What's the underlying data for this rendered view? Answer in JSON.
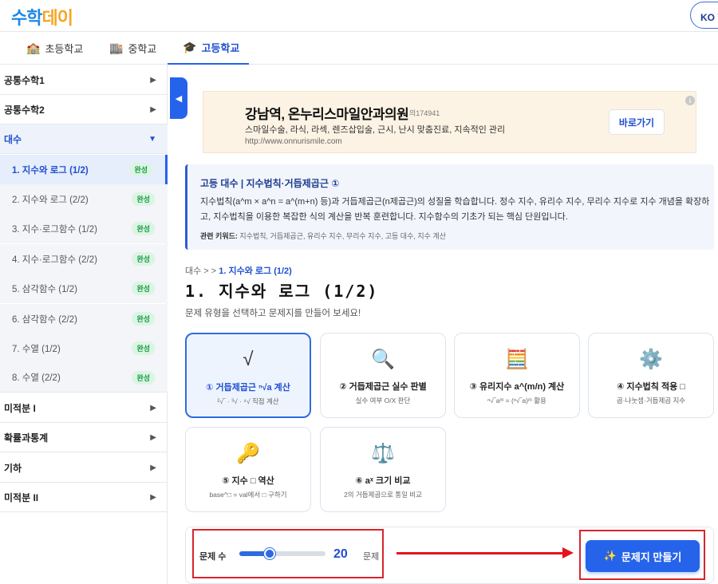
{
  "header": {
    "logo_main": "수학",
    "logo_accent": "데이",
    "lang_button": "KO 한"
  },
  "tabs": [
    {
      "label": "초등학교",
      "icon": "school-icon"
    },
    {
      "label": "중학교",
      "icon": "building-icon"
    },
    {
      "label": "고등학교",
      "icon": "graduation-cap-icon",
      "active": true
    }
  ],
  "sidebar": {
    "categories": {
      "c1": "공통수학1",
      "c2": "공통수학2",
      "c3": "대수",
      "c4": "미적분 I",
      "c5": "확률과통계",
      "c6": "기하",
      "c7": "미적분 II"
    },
    "items": [
      {
        "label": "1. 지수와 로그 (1/2)",
        "badge": "완성",
        "active": true
      },
      {
        "label": "2. 지수와 로그 (2/2)",
        "badge": "완성"
      },
      {
        "label": "3. 지수·로그함수 (1/2)",
        "badge": "완성"
      },
      {
        "label": "4. 지수·로그함수 (2/2)",
        "badge": "완성"
      },
      {
        "label": "5. 삼각함수 (1/2)",
        "badge": "완성"
      },
      {
        "label": "6. 삼각함수 (2/2)",
        "badge": "완성"
      },
      {
        "label": "7. 수열 (1/2)",
        "badge": "완성"
      },
      {
        "label": "8. 수열 (2/2)",
        "badge": "완성"
      }
    ]
  },
  "ad": {
    "title": "강남역, 온누리스마일안과의원",
    "id": "의174941",
    "desc": "스마일수술, 라식, 라섹, 렌즈삽입술, 근시, 난시 맞춤진료, 지속적인 관리",
    "url": "http://www.onnurismile.com",
    "button": "바로가기",
    "info": "i"
  },
  "info": {
    "title": "고등 대수 | 지수법칙·거듭제곱근 ①",
    "body": "지수법칙(a^m × a^n = a^(m+n) 등)과 거듭제곱근(n제곱근)의 성질을 학습합니다. 정수 지수, 유리수 지수, 무리수 지수로 지수 개념을 확장하고, 지수법칙을 이용한 복잡한 식의 계산을 반복 훈련합니다. 지수함수의 기초가 되는 핵심 단원입니다.",
    "keywords_label": "관련 키워드:",
    "keywords": "지수법칙, 거듭제곱근, 유리수 지수, 무리수 지수, 고등 대수, 지수 계산"
  },
  "breadcrumb": {
    "parent": "대수 > >",
    "current": "1. 지수와 로그 (1/2)"
  },
  "page": {
    "title": "1. 지수와 로그 (1/2)",
    "subtitle": "문제 유형을 선택하고 문제지를 만들어 보세요!"
  },
  "cards": [
    {
      "icon": "√",
      "icon_name": "sqrt-icon",
      "title": "① 거듭제곱근 ⁿ√a 계산",
      "sub": "²√‾ · ³√ · ⁴√ 직접 계산",
      "selected": true
    },
    {
      "icon": "🔍",
      "icon_name": "magnifier-icon",
      "title": "② 거듭제곱근 실수 판별",
      "sub": "실수 여부 O/X 판단"
    },
    {
      "icon": "🧮",
      "icon_name": "abacus-icon",
      "title": "③ 유리지수 a^(m/n) 계산",
      "sub": "ⁿ√‾aᵐ = (ⁿ√‾a)ᵐ 활용"
    },
    {
      "icon": "⚙️",
      "icon_name": "gear-icon",
      "title": "④ 지수법칙 적용 □",
      "sub": "곱·나눗셈·거듭제곱 지수"
    },
    {
      "icon": "🔑",
      "icon_name": "key-icon",
      "title": "⑤ 지수 □ 역산",
      "sub": "base^□ = val에서 □ 구하기"
    },
    {
      "icon": "⚖️",
      "icon_name": "balance-scale-icon",
      "title": "⑥ aˣ 크기 비교",
      "sub": "2의 거듭제곱으로 통일 비교"
    }
  ],
  "controls": {
    "count_label": "문제 수",
    "count_value": "20",
    "count_unit": "문제",
    "slider_fraction": 0.35,
    "make_button": "문제지 만들기",
    "make_icon": "✨"
  },
  "colors": {
    "primary": "#2563eb",
    "highlight": "#d9232d",
    "badge_bg": "#dcf5e3",
    "badge_text": "#1a9c4b"
  }
}
